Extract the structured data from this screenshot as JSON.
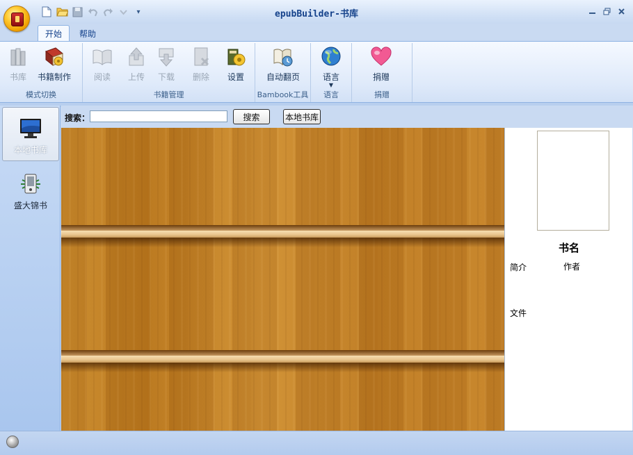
{
  "window": {
    "title": "epubBuilder-书库",
    "tabs": [
      "开始",
      "帮助"
    ]
  },
  "ribbon": {
    "groups": {
      "mode": {
        "label": "模式切换",
        "buttons": {
          "library": "书库",
          "make": "书籍制作"
        }
      },
      "manage": {
        "label": "书籍管理",
        "buttons": {
          "read": "阅读",
          "upload": "上传",
          "download": "下载",
          "delete": "删除",
          "settings": "设置"
        }
      },
      "bambook": {
        "label": "Bambook工具",
        "buttons": {
          "autopage": "自动翻页"
        }
      },
      "language": {
        "label": "语言",
        "buttons": {
          "language": "语言"
        }
      },
      "donate": {
        "label": "捐赠",
        "buttons": {
          "donate": "捐赠"
        }
      }
    }
  },
  "sidebar": {
    "items": [
      {
        "label": "本地书库",
        "icon": "monitor-icon",
        "active": true
      },
      {
        "label": "盛大锦书",
        "icon": "ebook-reader-icon",
        "active": false
      }
    ]
  },
  "search": {
    "label": "搜索：",
    "value": "",
    "button": "搜索",
    "local_button": "本地书库"
  },
  "detail": {
    "book_name": "书名",
    "intro_label": "简介",
    "author_label": "作者",
    "file_label": "文件"
  },
  "colors": {
    "accent": "#15428b",
    "ribbon_bg": "#dfeafa",
    "shelf_wood": "#c98a2c"
  }
}
